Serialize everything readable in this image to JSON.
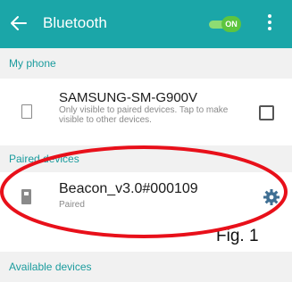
{
  "appbar": {
    "title": "Bluetooth",
    "toggle_label": "ON"
  },
  "sections": {
    "my_phone": "My phone",
    "paired": "Paired devices",
    "available": "Available devices"
  },
  "my_phone": {
    "name": "SAMSUNG-SM-G900V",
    "visibility_text": "Only visible to paired devices. Tap to make visible to other devices."
  },
  "paired_device": {
    "name": "Beacon_v3.0#000109",
    "status": "Paired"
  },
  "annotation": {
    "figure_label": "Fig. 1"
  },
  "colors": {
    "appbar": "#1ba6a8",
    "section_text": "#1b9c9e",
    "toggle_on": "#5dc53f",
    "annotation_oval": "#e8101a"
  }
}
